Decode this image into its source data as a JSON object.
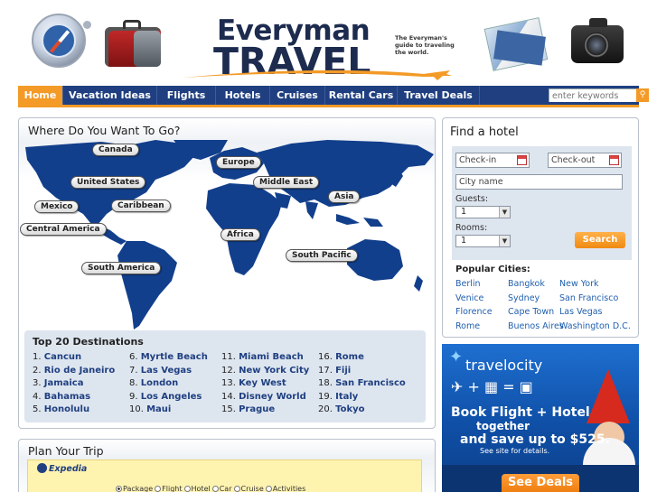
{
  "brand": {
    "logo_top": "Everyman",
    "logo_bottom": "TRAVEL",
    "tagline": "The Everyman's guide to traveling the world."
  },
  "nav": {
    "items": [
      "Home",
      "Vacation Ideas",
      "Flights",
      "Hotels",
      "Cruises",
      "Rental Cars",
      "Travel Deals"
    ],
    "active": "Home",
    "search_placeholder": "enter keywords"
  },
  "where": {
    "title": "Where Do You Want To Go?",
    "regions": [
      "Canada",
      "United States",
      "Mexico",
      "Caribbean",
      "Central America",
      "South America",
      "Europe",
      "Middle East",
      "Asia",
      "Africa",
      "South Pacific"
    ]
  },
  "top20": {
    "title": "Top 20 Destinations",
    "items": [
      {
        "num": "1.",
        "name": "Cancun"
      },
      {
        "num": "2.",
        "name": "Rio de Janeiro"
      },
      {
        "num": "3.",
        "name": "Jamaica"
      },
      {
        "num": "4.",
        "name": "Bahamas"
      },
      {
        "num": "5.",
        "name": "Honolulu"
      },
      {
        "num": "6.",
        "name": "Myrtle Beach"
      },
      {
        "num": "7.",
        "name": "Las Vegas"
      },
      {
        "num": "8.",
        "name": "London"
      },
      {
        "num": "9.",
        "name": "Los Angeles"
      },
      {
        "num": "10.",
        "name": "Maui"
      },
      {
        "num": "11.",
        "name": "Miami Beach"
      },
      {
        "num": "12.",
        "name": "New York City"
      },
      {
        "num": "13.",
        "name": "Key West"
      },
      {
        "num": "14.",
        "name": "Disney World"
      },
      {
        "num": "15.",
        "name": "Prague"
      },
      {
        "num": "16.",
        "name": "Rome"
      },
      {
        "num": "17.",
        "name": "Fiji"
      },
      {
        "num": "18.",
        "name": "San Francisco"
      },
      {
        "num": "19.",
        "name": "Italy"
      },
      {
        "num": "20.",
        "name": "Tokyo"
      }
    ]
  },
  "plan": {
    "title": "Plan Your Trip",
    "powered_by": "Expedia",
    "options": [
      "Package",
      "Flight",
      "Hotel",
      "Car",
      "Cruise",
      "Activities"
    ],
    "selected": "Package"
  },
  "hotel": {
    "title": "Find a hotel",
    "checkin_placeholder": "Check-in",
    "checkout_placeholder": "Check-out",
    "city_placeholder": "City name",
    "guests_label": "Guests:",
    "guests_value": "1",
    "rooms_label": "Rooms:",
    "rooms_value": "1",
    "search_label": "Search",
    "popular_title": "Popular Cities:",
    "cities": [
      "Berlin",
      "Bangkok",
      "New York",
      "Venice",
      "Sydney",
      "San Francisco",
      "Florence",
      "Cape Town",
      "Las Vegas",
      "Rome",
      "Buenos Aires",
      "Washington D.C."
    ]
  },
  "ad": {
    "brand": "travelocity",
    "line1": "Book Flight + Hotel",
    "line2": "together",
    "line3": "and save up to $525.",
    "line4": "See site for details.",
    "button": "See Deals"
  },
  "colors": {
    "nav_bg": "#1f3f80",
    "accent": "#f39a27",
    "link": "#1f5fae",
    "map_land": "#123f8c"
  }
}
